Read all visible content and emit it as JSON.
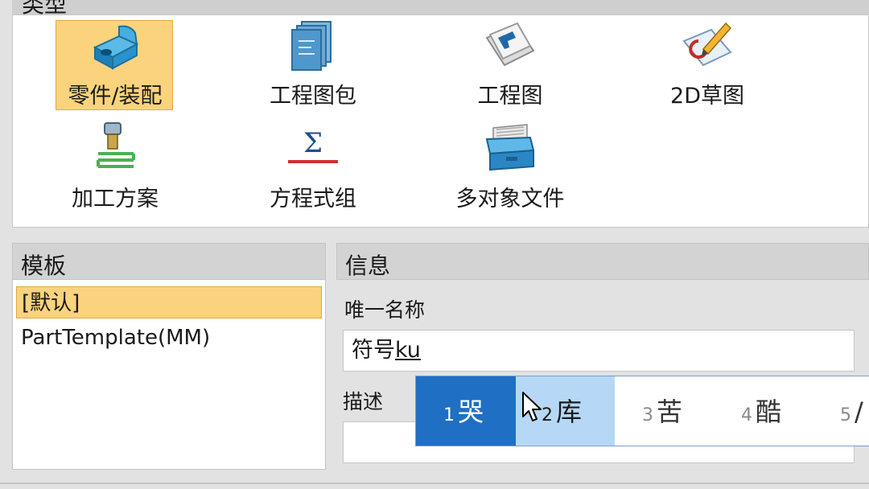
{
  "type_section": {
    "header_label": "类型",
    "tiles": [
      {
        "label": "零件/装配",
        "icon": "part-assembly-icon",
        "selected": true
      },
      {
        "label": "工程图包",
        "icon": "drawing-package-icon",
        "selected": false
      },
      {
        "label": "工程图",
        "icon": "drawing-icon",
        "selected": false
      },
      {
        "label": "2D草图",
        "icon": "sketch-2d-icon",
        "selected": false
      },
      {
        "label": "加工方案",
        "icon": "machining-plan-icon",
        "selected": false
      },
      {
        "label": "方程式组",
        "icon": "equation-set-icon",
        "selected": false
      },
      {
        "label": "多对象文件",
        "icon": "multi-object-file-icon",
        "selected": false
      }
    ]
  },
  "template_section": {
    "header_label": "模板",
    "items": [
      "[默认]",
      "PartTemplate(MM)"
    ],
    "selected_index": 0
  },
  "info_section": {
    "header_label": "信息",
    "unique_name_label": "唯一名称",
    "unique_name_value": "符号",
    "unique_name_composition": "ku",
    "description_label": "描述",
    "description_value": ""
  },
  "ime_popup": {
    "candidates": [
      {
        "index": "1",
        "text": "哭"
      },
      {
        "index": "2",
        "text": "库"
      },
      {
        "index": "3",
        "text": "苦"
      },
      {
        "index": "4",
        "text": "酷"
      },
      {
        "index": "5",
        "text": "/"
      }
    ],
    "active_index": 0,
    "hover_index": 1
  },
  "colors": {
    "selection": "#fbd37c",
    "ime_active": "#1f6fc5",
    "ime_hover": "#b6d7f5"
  }
}
